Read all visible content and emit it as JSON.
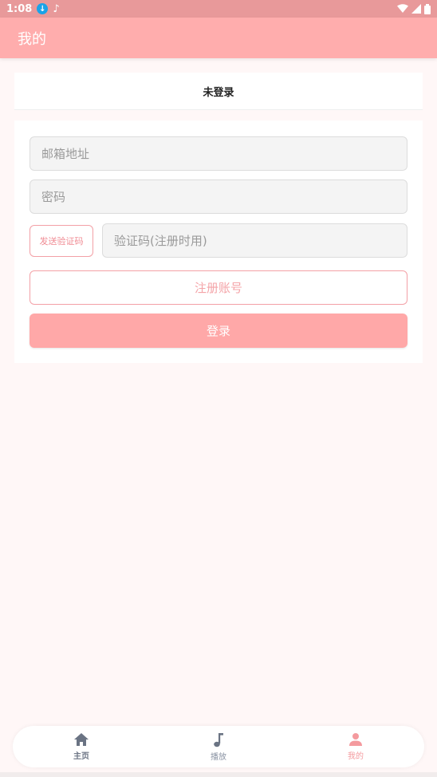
{
  "status_bar": {
    "time": "1:08",
    "icons": [
      "download-icon",
      "music-note-icon",
      "wifi-icon",
      "signal-icon",
      "battery-icon"
    ]
  },
  "app_bar": {
    "title": "我的"
  },
  "login_status": {
    "label": "未登录"
  },
  "form": {
    "email_placeholder": "邮箱地址",
    "password_placeholder": "密码",
    "send_code_label": "发送验证码",
    "code_placeholder": "验证码(注册时用)",
    "register_label": "注册账号",
    "login_label": "登录"
  },
  "bottom_nav": {
    "items": [
      {
        "label": "主页",
        "icon": "home-icon"
      },
      {
        "label": "播放",
        "icon": "music-note-icon"
      },
      {
        "label": "我的",
        "icon": "person-icon"
      }
    ],
    "active_index": 2
  },
  "colors": {
    "accent": "#ffadad",
    "status_bar": "#e8999a",
    "background": "#fff7f7",
    "active_nav": "#f49a9e"
  }
}
